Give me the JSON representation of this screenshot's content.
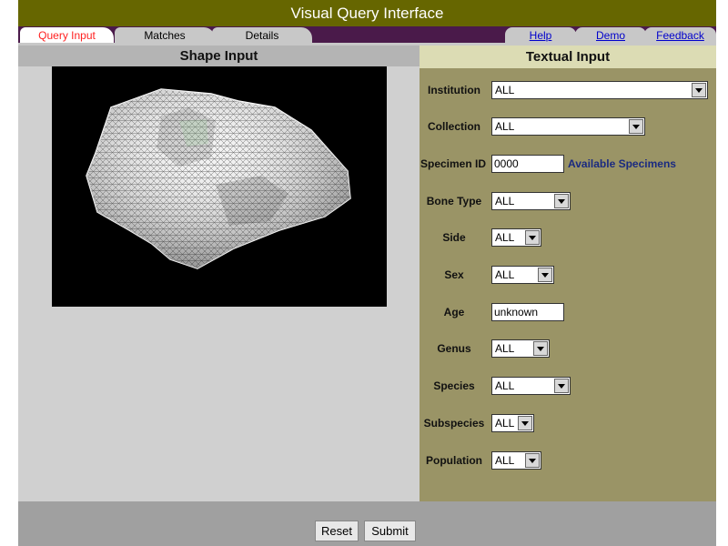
{
  "header": {
    "title": "Visual Query Interface"
  },
  "tabs": [
    {
      "label": "Query Input"
    },
    {
      "label": "Matches"
    },
    {
      "label": "Details"
    }
  ],
  "util_links": [
    {
      "label": "Help"
    },
    {
      "label": "Demo"
    },
    {
      "label": "Feedback"
    }
  ],
  "shape_panel": {
    "title": "Shape Input"
  },
  "text_panel": {
    "title": "Textual Input",
    "fields": {
      "institution": {
        "label": "Institution",
        "value": "ALL"
      },
      "collection": {
        "label": "Collection",
        "value": "ALL"
      },
      "specimen_id": {
        "label": "Specimen ID",
        "value": "0000",
        "link": "Available Specimens"
      },
      "bone_type": {
        "label": "Bone Type",
        "value": "ALL"
      },
      "side": {
        "label": "Side",
        "value": "ALL"
      },
      "sex": {
        "label": "Sex",
        "value": "ALL"
      },
      "age": {
        "label": "Age",
        "value": "unknown"
      },
      "genus": {
        "label": "Genus",
        "value": "ALL"
      },
      "species": {
        "label": "Species",
        "value": "ALL"
      },
      "subspecies": {
        "label": "Subspecies",
        "value": "ALL"
      },
      "population": {
        "label": "Population",
        "value": "ALL"
      }
    }
  },
  "buttons": {
    "reset": "Reset",
    "submit": "Submit"
  },
  "colors": {
    "title_bar": "#666600",
    "tab_bar": "#4a1a4a",
    "active_tab_text": "#ff2020",
    "text_panel_bg": "#9a9466",
    "shape_panel_bg": "#d0d0d0"
  }
}
